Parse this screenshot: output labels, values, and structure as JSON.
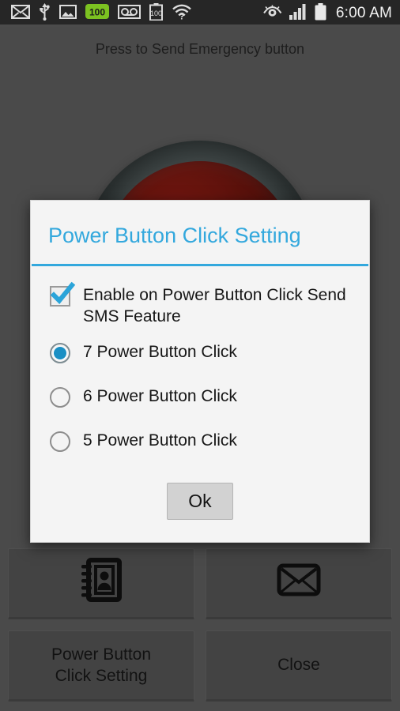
{
  "status_bar": {
    "left_icons": [
      {
        "name": "email-icon",
        "label": "Email"
      },
      {
        "name": "usb-icon",
        "label": "USB"
      },
      {
        "name": "screenshot-image-icon",
        "label": "Screenshot"
      },
      {
        "name": "battery-full-badge-icon",
        "label": "100"
      },
      {
        "name": "voicemail-icon",
        "label": "Voicemail"
      },
      {
        "name": "battery-level-icon",
        "label": "100"
      },
      {
        "name": "wifi-unknown-icon",
        "label": "Wi-Fi"
      }
    ],
    "right_icons": [
      {
        "name": "smart-stay-eye-icon",
        "label": "Smart stay"
      },
      {
        "name": "signal-bars-icon",
        "label": "Signal"
      },
      {
        "name": "battery-icon",
        "label": "Battery"
      }
    ],
    "clock": "6:00 AM"
  },
  "app": {
    "hint_text": "Press to Send Emergency button",
    "emergency_button_name": "emergency-send-button",
    "buttons": [
      {
        "name": "contacts-button",
        "icon": "address-book-icon",
        "label": ""
      },
      {
        "name": "message-button",
        "icon": "envelope-icon",
        "label": ""
      },
      {
        "name": "power-button-click-setting-button",
        "icon": "",
        "label": "Power Button\nClick Setting"
      },
      {
        "name": "close-button",
        "icon": "",
        "label": "Close"
      }
    ]
  },
  "dialog": {
    "title": "Power Button Click Setting",
    "accent_color": "#33a8dd",
    "checkbox": {
      "label": "Enable on Power Button Click Send SMS Feature",
      "checked": true
    },
    "radio_options": [
      {
        "label": "7 Power Button Click",
        "selected": true
      },
      {
        "label": "6 Power Button Click",
        "selected": false
      },
      {
        "label": "5 Power Button Click",
        "selected": false
      }
    ],
    "ok_label": "Ok"
  }
}
